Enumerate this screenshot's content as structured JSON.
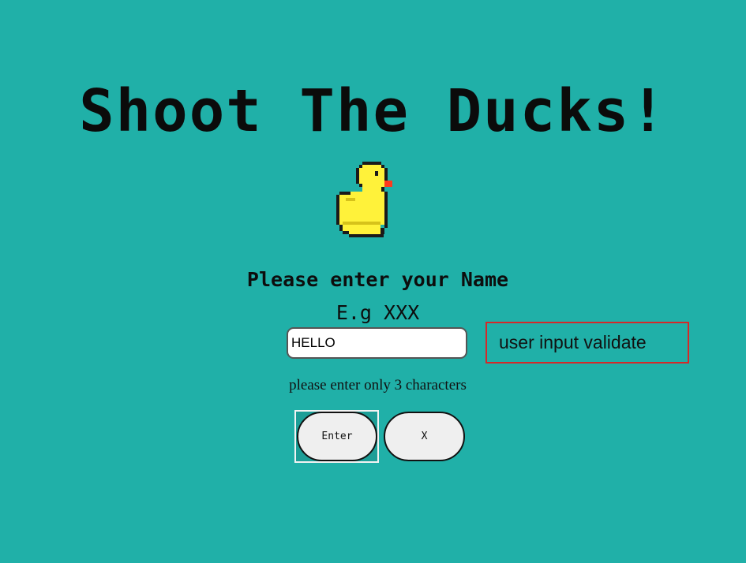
{
  "game": {
    "title": "Shoot The Ducks!"
  },
  "form": {
    "prompt": "Please enter your Name",
    "example": "E.g XXX",
    "name_value": "HELLO",
    "hint": "please enter only 3 characters",
    "enter_label": "Enter",
    "close_label": "X"
  },
  "annotation": {
    "label": "user input validate",
    "border_color": "#d62828"
  },
  "icons": {
    "duck": "duck-icon"
  },
  "colors": {
    "background": "#20b0a8",
    "duck_body": "#fff23a",
    "duck_beak": "#ff3b1f",
    "annotation_border": "#d62828"
  }
}
